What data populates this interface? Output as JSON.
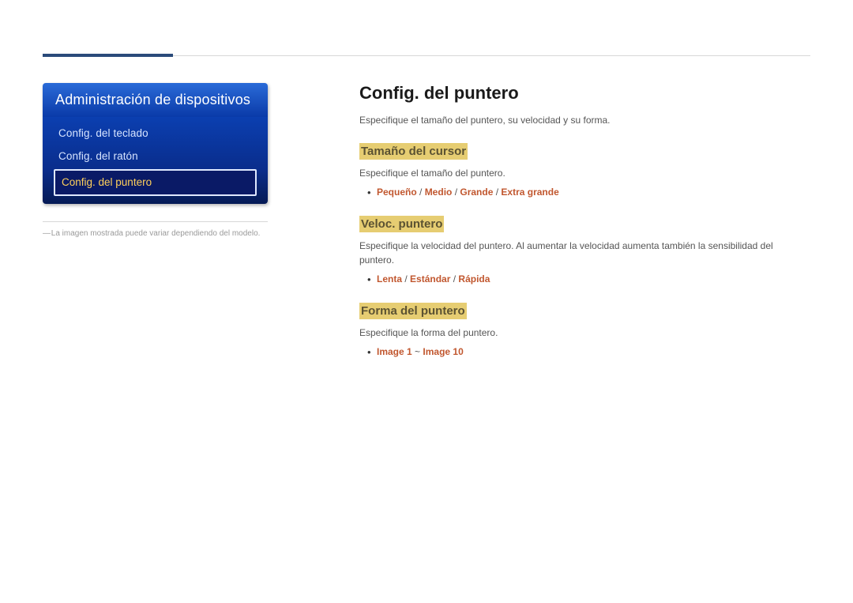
{
  "sidebar": {
    "header": "Administración de dispositivos",
    "items": [
      {
        "label": "Config. del teclado"
      },
      {
        "label": "Config. del ratón"
      },
      {
        "label": "Config. del puntero"
      }
    ],
    "note": "La imagen mostrada puede variar dependiendo del modelo."
  },
  "content": {
    "title": "Config. del puntero",
    "intro": "Especifique el tamaño del puntero, su velocidad y su forma.",
    "sections": [
      {
        "title": "Tamaño del cursor",
        "desc": "Especifique el tamaño del puntero.",
        "options": [
          "Pequeño",
          "Medio",
          "Grande",
          "Extra grande"
        ],
        "sep": "slash"
      },
      {
        "title": "Veloc. puntero",
        "desc": "Especifique la velocidad del puntero. Al aumentar la velocidad aumenta también la sensibilidad del puntero.",
        "options": [
          "Lenta",
          "Estándar",
          "Rápida"
        ],
        "sep": "slash"
      },
      {
        "title": "Forma del puntero",
        "desc": "Especifique la forma del puntero.",
        "options": [
          "Image 1",
          "Image 10"
        ],
        "sep": "tilde"
      }
    ]
  }
}
